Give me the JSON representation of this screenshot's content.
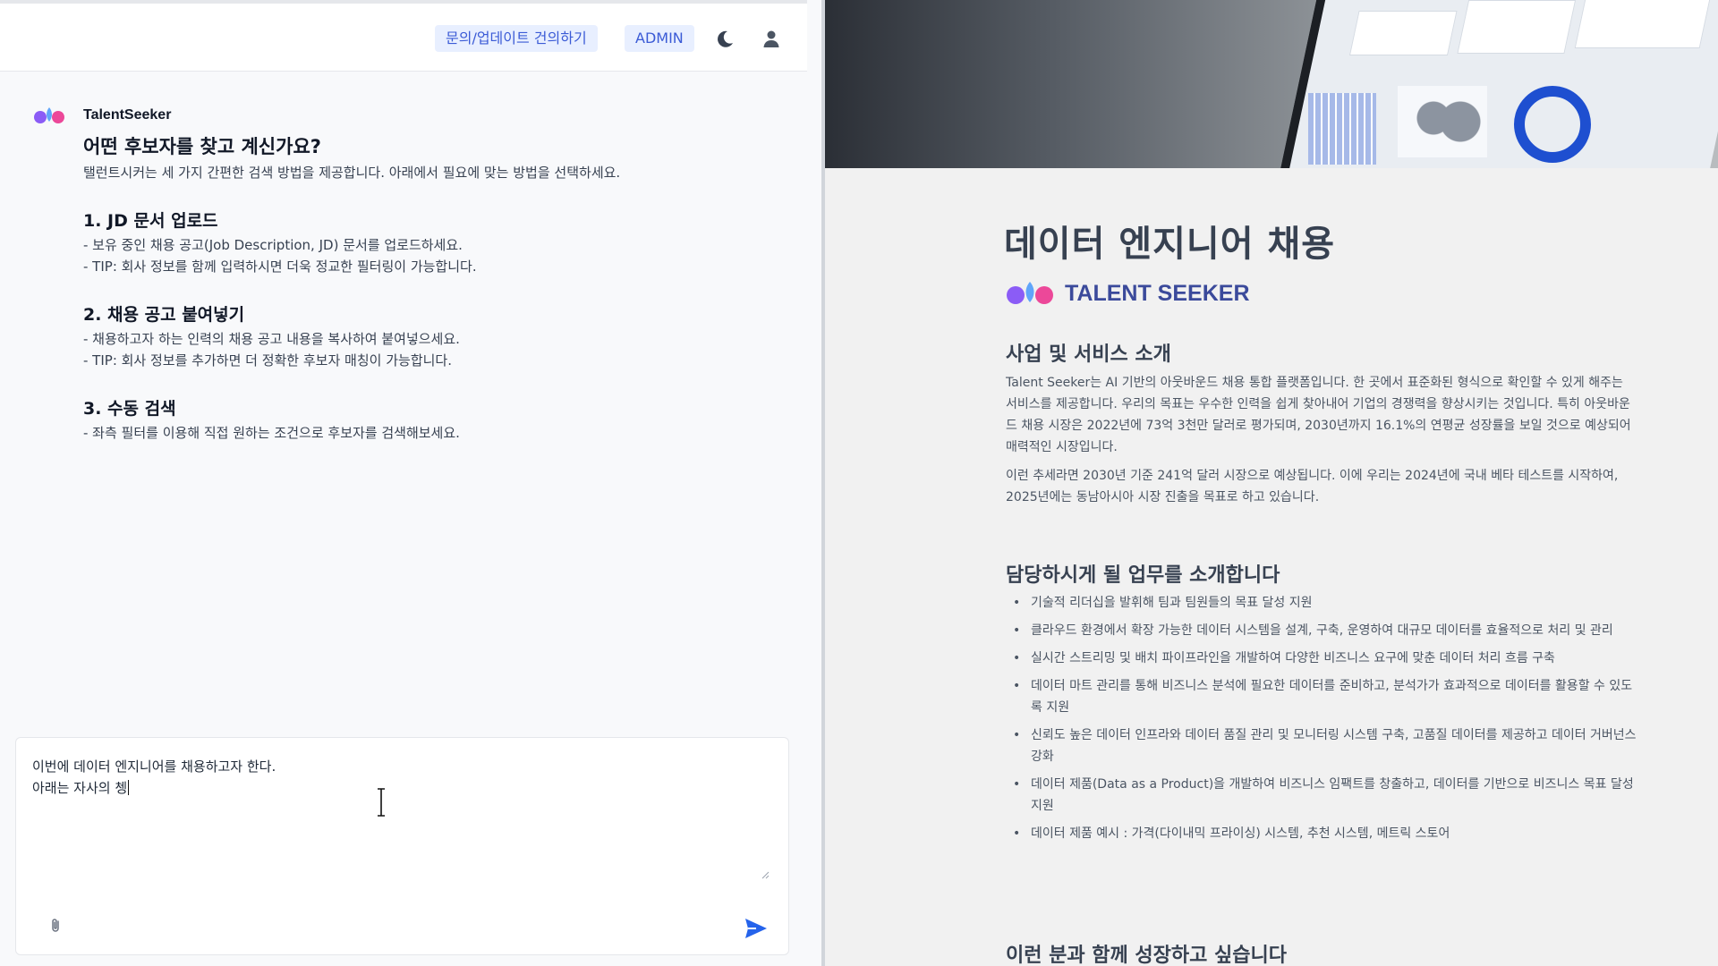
{
  "header": {
    "inquiry_label": "문의/업데이트 건의하기",
    "admin_label": "ADMIN",
    "icons": [
      "moon-icon",
      "user-icon"
    ]
  },
  "chat": {
    "bot_name": "TalentSeeker",
    "title": "어떤 후보자를 찾고 계신가요?",
    "intro": "탤런트시커는 세 가지 간편한 검색 방법을 제공합니다. 아래에서 필요에 맞는 방법을 선택하세요.",
    "sections": [
      {
        "heading": "1. JD 문서 업로드",
        "lines": [
          "- 보유 중인 채용 공고(Job Description, JD) 문서를 업로드하세요.",
          "- TIP: 회사 정보를 함께 입력하시면 더욱 정교한 필터링이 가능합니다."
        ]
      },
      {
        "heading": "2. 채용 공고 붙여넣기",
        "lines": [
          "- 채용하고자 하는 인력의 채용 공고 내용을 복사하여 붙여넣으세요.",
          "- TIP: 회사 정보를 추가하면 더 정확한 후보자 매칭이 가능합니다."
        ]
      },
      {
        "heading": "3. 수동 검색",
        "lines": [
          "- 좌측 필터를 이용해 직접 원하는 조건으로 후보자를 검색해보세요."
        ]
      }
    ],
    "composer_text": "이번에 데이터 엔지니어를 채용하고자 한다.\n아래는 자사의 쳉",
    "icons": [
      "paperclip-icon",
      "send-icon"
    ]
  },
  "posting": {
    "title": "데이터 엔지니어 채용",
    "brand": "TALENT SEEKER",
    "about_heading": "사업 및 서비스 소개",
    "about_p1": "Talent Seeker는 AI 기반의 아웃바운드 채용 통합 플랫폼입니다. 한 곳에서 표준화된 형식으로 확인할 수 있게 해주는 서비스를 제공합니다. 우리의 목표는 우수한 인력을 쉽게 찾아내어 기업의 경쟁력을 향상시키는 것입니다. 특히 아웃바운드 채용 시장은 2022년에 73억 3천만 달러로 평가되며, 2030년까지 16.1%의 연평균 성장률을 보일 것으로 예상되어 매력적인 시장입니다.",
    "about_p2": "이런 추세라면 2030년 기준 241억 달러 시장으로 예상됩니다. 이에 우리는 2024년에 국내 베타 테스트를 시작하여, 2025년에는 동남아시아 시장 진출을 목표로 하고 있습니다.",
    "duties_heading": "담당하시게 될 업무를 소개합니다",
    "duties": [
      "기술적 리더십을 발휘해 팀과 팀원들의 목표 달성 지원",
      "클라우드 환경에서 확장 가능한 데이터 시스템을 설계, 구축, 운영하여 대규모 데이터를 효율적으로 처리 및 관리",
      "실시간 스트리밍 및 배치 파이프라인을 개발하여 다양한 비즈니스 요구에 맞춘 데이터 처리 흐름 구축",
      "데이터 마트 관리를 통해 비즈니스 분석에 필요한 데이터를 준비하고, 분석가가 효과적으로 데이터를 활용할 수 있도록 지원",
      "신뢰도 높은 데이터 인프라와 데이터 품질 관리 및 모니터링 시스템 구축, 고품질 데이터를 제공하고 데이터 거버넌스 강화",
      "데이터 제품(Data as a Product)을 개발하여 비즈니스 임팩트를 창출하고, 데이터를 기반으로 비즈니스 목표 달성 지원",
      "데이터 제품 예시 : 가격(다이내믹 프라이싱) 시스템, 추천 시스템, 메트릭 스토어"
    ],
    "next_heading": "이런 분과 함께 성장하고 싶습니다",
    "colors": {
      "accent": "#3b5bd6",
      "brand": "#3b4a9b",
      "send": "#2563eb"
    }
  }
}
